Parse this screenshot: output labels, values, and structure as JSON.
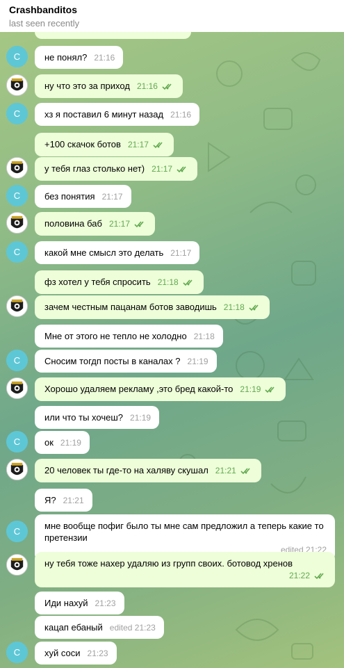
{
  "header": {
    "title": "Crashbanditos",
    "status": "last seen recently"
  },
  "avatars": {
    "incoming_letter": "C"
  },
  "colors": {
    "incoming_avatar": "#5ec7d6",
    "outgoing_bubble": "#eefed9",
    "read_check": "#60a94f"
  },
  "messages": [
    {
      "text": "не понял?",
      "time": "21:16",
      "dir": "in"
    },
    {
      "text": "ну что это за приход",
      "time": "21:16",
      "dir": "out"
    },
    {
      "text": "хз я поставил 6 минут назад",
      "time": "21:16",
      "dir": "in"
    },
    {
      "text": "+100 скачок ботов",
      "time": "21:17",
      "dir": "out"
    },
    {
      "text": "у тебя глаз столько нет)",
      "time": "21:17",
      "dir": "out"
    },
    {
      "text": "без понятия",
      "time": "21:17",
      "dir": "in"
    },
    {
      "text": "половина баб",
      "time": "21:17",
      "dir": "out"
    },
    {
      "text": "какой мне смысл это делать",
      "time": "21:17",
      "dir": "in"
    },
    {
      "text": "фз хотел у тебя спросить",
      "time": "21:18",
      "dir": "out"
    },
    {
      "text": "зачем честным пацанам ботов заводишь",
      "time": "21:18",
      "dir": "out"
    },
    {
      "text": "Мне от этого не тепло не холодно",
      "time": "21:18",
      "dir": "in"
    },
    {
      "text": "Сносим тогдп посты в каналах ?",
      "time": "21:19",
      "dir": "in"
    },
    {
      "text": "Хорошо удаляем рекламу ,это бред какой-то",
      "time": "21:19",
      "dir": "out"
    },
    {
      "text": "или что ты хочеш?",
      "time": "21:19",
      "dir": "in"
    },
    {
      "text": "ок",
      "time": "21:19",
      "dir": "in"
    },
    {
      "text": "20 человек ты где-то на халяву скушал",
      "time": "21:21",
      "dir": "out"
    },
    {
      "text": "Я?",
      "time": "21:21",
      "dir": "in"
    },
    {
      "text": "мне вообще пофиг было ты мне сам предложил а теперь какие то претензии",
      "time": "edited 21:22",
      "dir": "in"
    },
    {
      "text": "ну тебя тоже нахер удаляю из групп своих. ботовод хренов",
      "time": "21:22",
      "dir": "out"
    },
    {
      "text": "Иди нахуй",
      "time": "21:23",
      "dir": "in"
    },
    {
      "text": "кацап ебаный",
      "time": "edited 21:23",
      "dir": "in"
    },
    {
      "text": "хуй соси",
      "time": "21:23",
      "dir": "in"
    }
  ]
}
